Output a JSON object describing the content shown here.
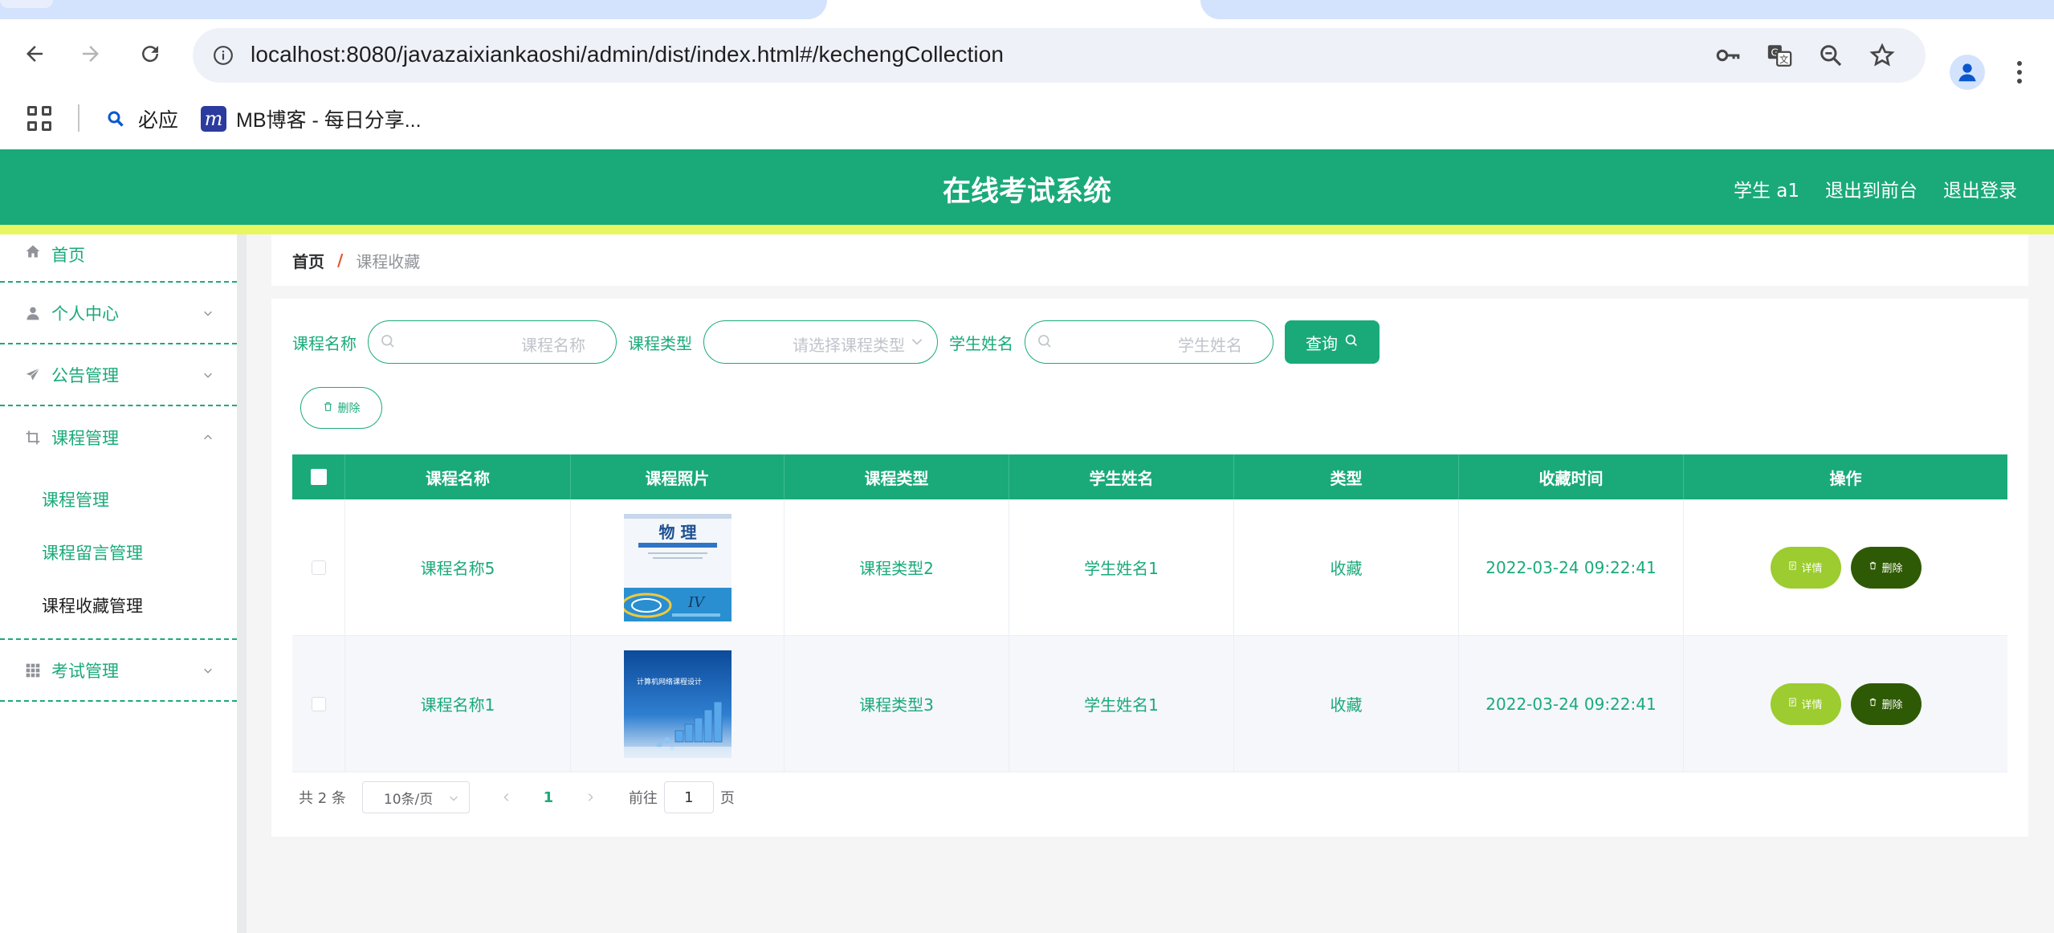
{
  "browser": {
    "url": "localhost:8080/javazaixiankaoshi/admin/dist/index.html#/kechengCollection",
    "bookmarks": [
      {
        "label": "必应",
        "icon": "search-icon"
      },
      {
        "label": "MB博客 - 每日分享...",
        "icon": "mb-blog-logo"
      }
    ],
    "mb_logo_letter": "m"
  },
  "header": {
    "title": "在线考试系统",
    "links": [
      "学生 a1",
      "退出到前台",
      "退出登录"
    ],
    "bg_color": "#1aaa7a",
    "strip_color": "#e8f760"
  },
  "sidebar": {
    "items": [
      {
        "label": "首页",
        "icon": "home-icon"
      },
      {
        "label": "个人中心",
        "icon": "user-icon",
        "expanded": false
      },
      {
        "label": "公告管理",
        "icon": "paper-plane-icon",
        "expanded": false
      },
      {
        "label": "课程管理",
        "icon": "crop-icon",
        "expanded": true,
        "children": [
          "课程管理",
          "课程留言管理",
          "课程收藏管理"
        ],
        "active_child": "课程收藏管理"
      },
      {
        "label": "考试管理",
        "icon": "grid-icon",
        "expanded": false
      }
    ]
  },
  "breadcrumb": {
    "home": "首页",
    "separator": "/",
    "current": "课程收藏"
  },
  "search": {
    "course_name_label": "课程名称",
    "course_name_placeholder": "课程名称",
    "course_type_label": "课程类型",
    "course_type_placeholder": "请选择课程类型",
    "student_name_label": "学生姓名",
    "student_name_placeholder": "学生姓名",
    "query_label": "查询",
    "delete_label": "删除"
  },
  "table": {
    "columns": [
      "课程名称",
      "课程照片",
      "课程类型",
      "学生姓名",
      "类型",
      "收藏时间",
      "操作"
    ],
    "rows": [
      {
        "course_name": "课程名称5",
        "photo": "physics-book-cover",
        "course_type": "课程类型2",
        "student": "学生姓名1",
        "type": "收藏",
        "time": "2022-03-24 09:22:41"
      },
      {
        "course_name": "课程名称1",
        "photo": "network-book-cover",
        "course_type": "课程类型3",
        "student": "学生姓名1",
        "type": "收藏",
        "time": "2022-03-24 09:22:41"
      }
    ],
    "detail_label": "详情",
    "delete_label": "删除"
  },
  "covers": {
    "physics_title": "物 理",
    "network_title": "计算机网络课程设计"
  },
  "pagination": {
    "total": "共 2 条",
    "page_size": "10条/页",
    "current_page": "1",
    "goto_prefix": "前往",
    "goto_value": "1",
    "goto_suffix": "页"
  }
}
